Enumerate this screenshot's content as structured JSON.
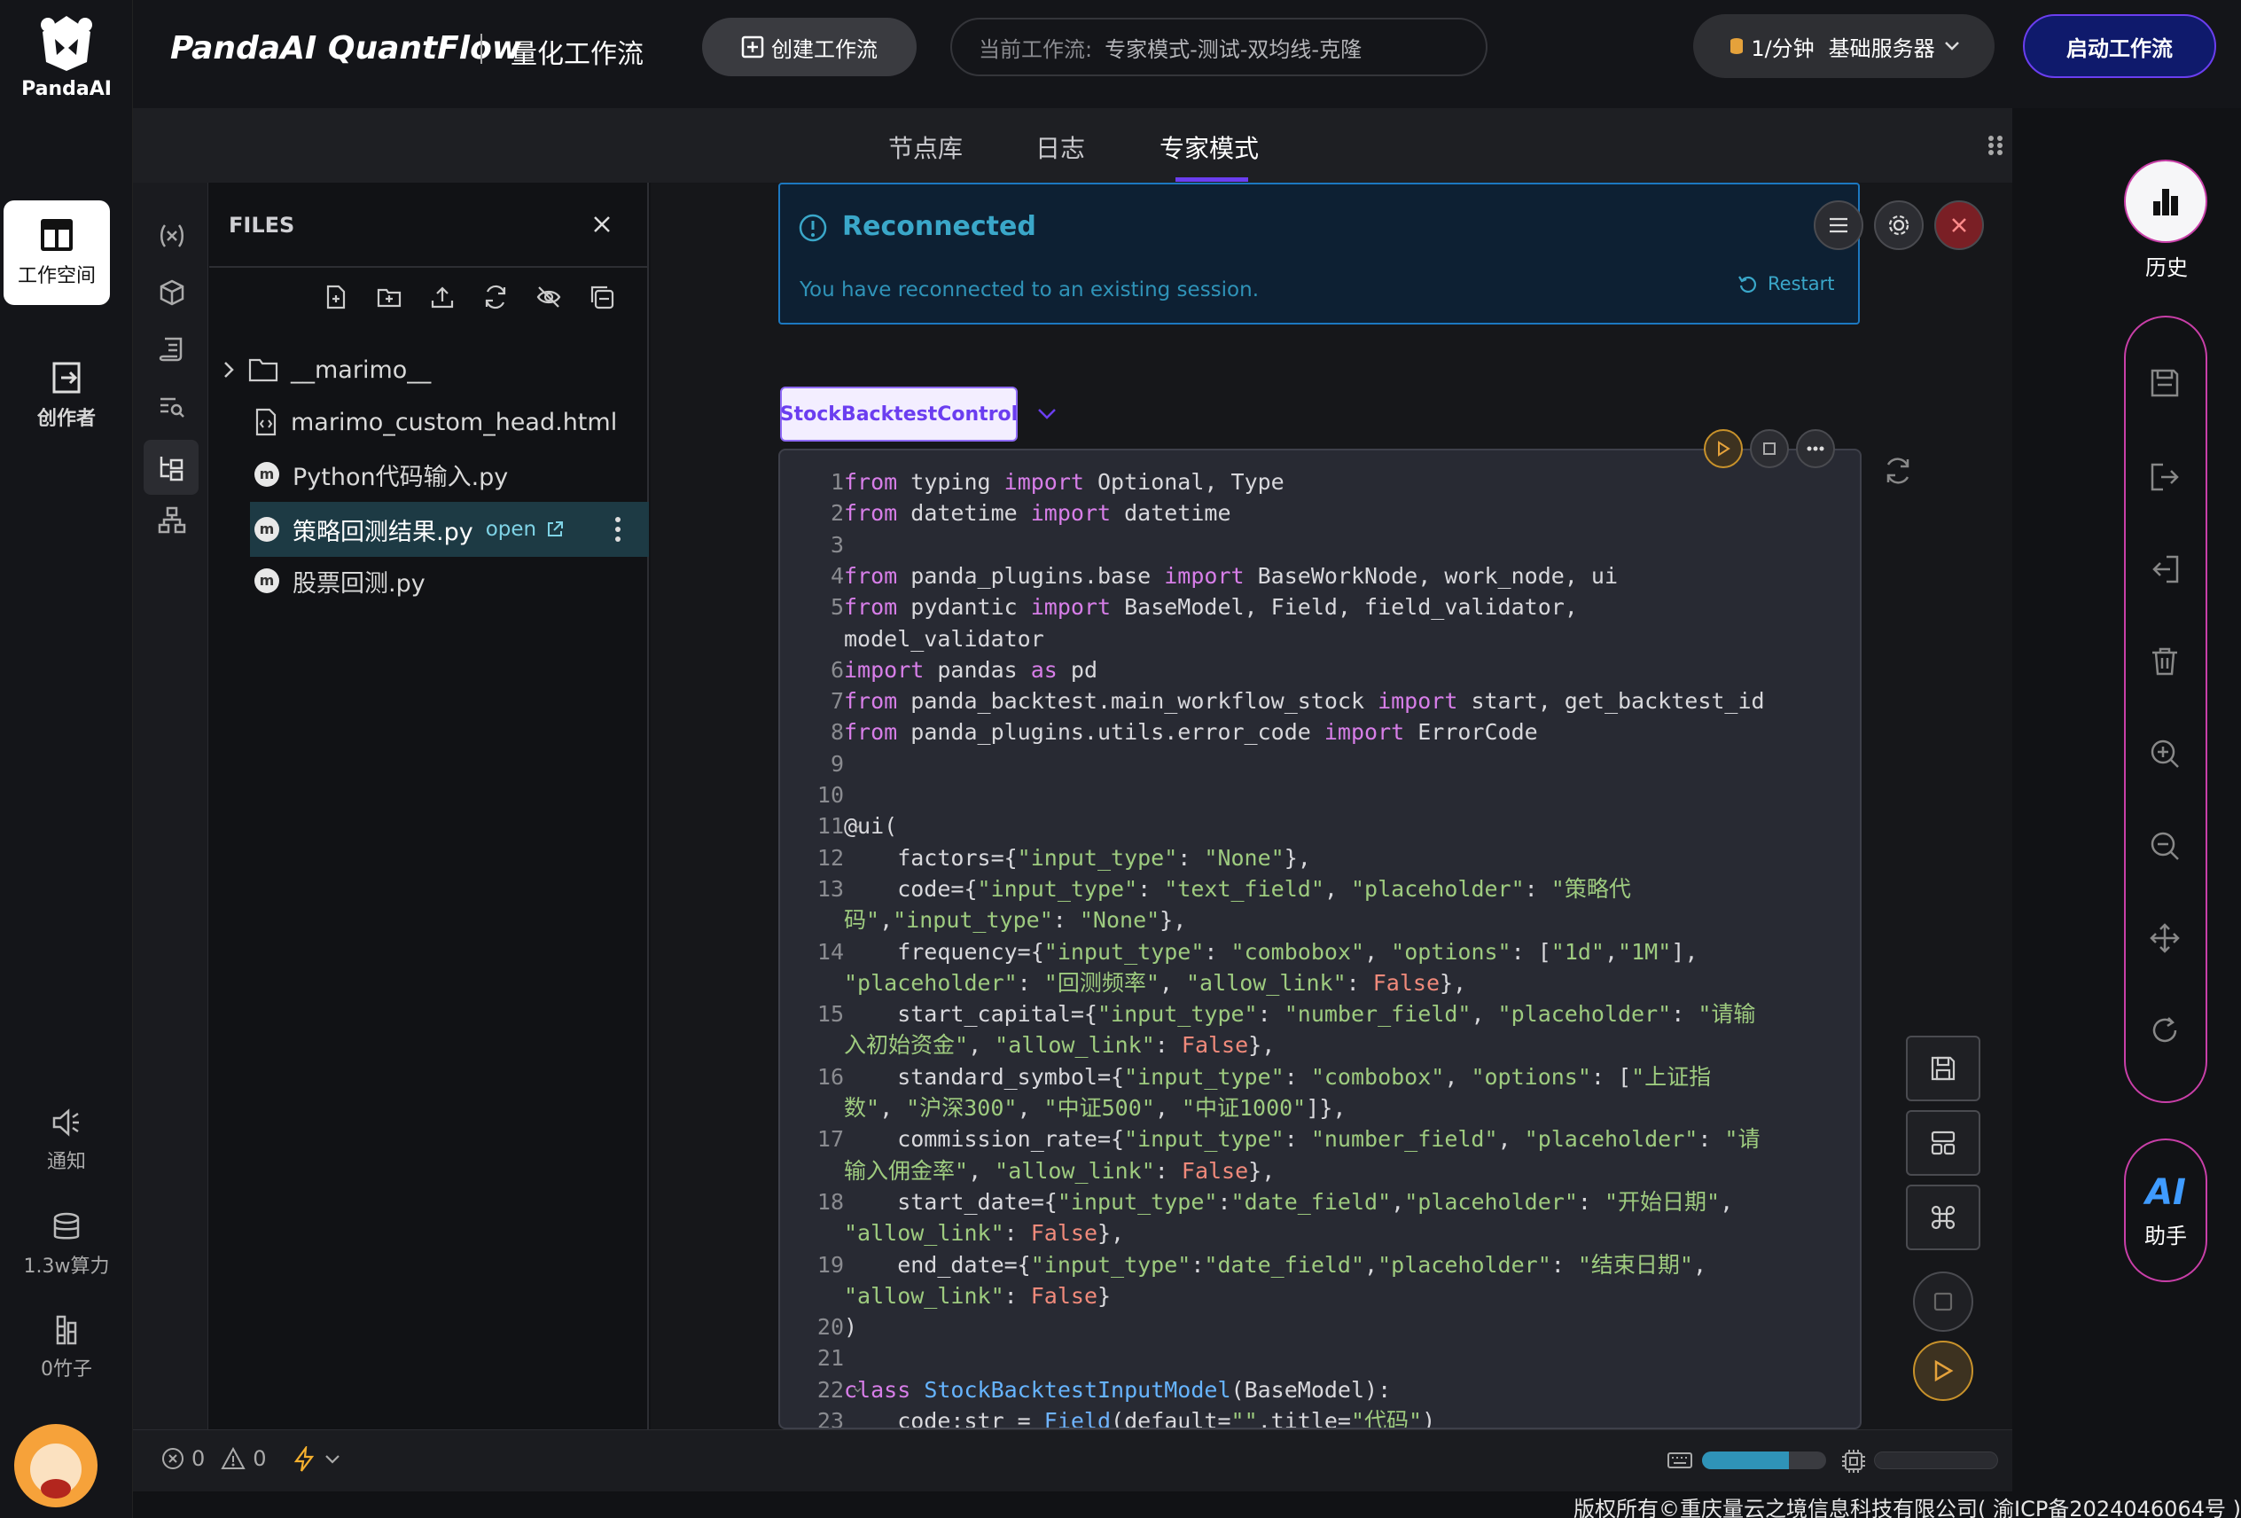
{
  "brand": {
    "logo_text": "PandaAI",
    "app_title": "PandaAI QuantFlow",
    "app_subtitle": "量化工作流"
  },
  "header": {
    "create_button": "创建工作流",
    "current_workflow_label": "当前工作流:",
    "current_workflow_name": "专家模式-测试-双均线-克隆",
    "server_rate": "1/分钟",
    "server_type": "基础服务器",
    "start_button": "启动工作流"
  },
  "left_rail": {
    "workspace": "工作空间",
    "creator": "创作者",
    "notify": "通知",
    "compute": "1.3w算力",
    "bamboo": "0竹子"
  },
  "tabs": [
    {
      "label": "节点库",
      "active": false
    },
    {
      "label": "日志",
      "active": false
    },
    {
      "label": "专家模式",
      "active": true
    }
  ],
  "files": {
    "title": "FILES",
    "items": [
      {
        "name": "__marimo__",
        "type": "folder"
      },
      {
        "name": "marimo_custom_head.html",
        "type": "html"
      },
      {
        "name": "Python代码输入.py",
        "type": "marimo"
      },
      {
        "name": "策略回测结果.py",
        "type": "marimo",
        "selected": true,
        "badge": "open"
      },
      {
        "name": "股票回测.py",
        "type": "marimo"
      }
    ]
  },
  "notice": {
    "title": "Reconnected",
    "message": "You have reconnected to an existing session.",
    "restart": "Restart"
  },
  "cell": {
    "name": "StockBacktestControl"
  },
  "code_lines": [
    {
      "n": "1",
      "fold": "",
      "html": "<span class='kw'>from</span> typing <span class='kw'>import</span> Optional, Type"
    },
    {
      "n": "2",
      "fold": "",
      "html": "<span class='kw'>from</span> datetime <span class='kw'>import</span> datetime"
    },
    {
      "n": "3",
      "fold": "",
      "html": ""
    },
    {
      "n": "4",
      "fold": "",
      "html": "<span class='kw'>from</span> panda_plugins.base <span class='kw'>import</span> BaseWorkNode, work_node, ui"
    },
    {
      "n": "5",
      "fold": "",
      "html": "<span class='kw'>from</span> pydantic <span class='kw'>import</span> BaseModel, Field, field_validator,"
    },
    {
      "n": "",
      "fold": "",
      "html": "model_validator"
    },
    {
      "n": "6",
      "fold": "",
      "html": "<span class='kw'>import</span> pandas <span class='kw'>as</span> pd"
    },
    {
      "n": "7",
      "fold": "",
      "html": "<span class='kw'>from</span> panda_backtest.main_workflow_stock <span class='kw'>import</span> start, get_backtest_id"
    },
    {
      "n": "8",
      "fold": "",
      "html": "<span class='kw'>from</span> panda_plugins.utils.error_code <span class='kw'>import</span> ErrorCode"
    },
    {
      "n": "9",
      "fold": "",
      "html": ""
    },
    {
      "n": "10",
      "fold": "",
      "html": ""
    },
    {
      "n": "11",
      "fold": "v",
      "html": "@ui("
    },
    {
      "n": "12",
      "fold": "",
      "html": "    factors={<span class='str'>\"input_type\"</span>: <span class='str'>\"None\"</span>},"
    },
    {
      "n": "13",
      "fold": "",
      "html": "    code={<span class='str'>\"input_type\"</span>: <span class='str'>\"text_field\"</span>, <span class='str'>\"placeholder\"</span>: <span class='str'>\"策略代</span>"
    },
    {
      "n": "",
      "fold": "",
      "html": "<span class='str'>码\"</span>,<span class='str'>\"input_type\"</span>: <span class='str'>\"None\"</span>},"
    },
    {
      "n": "14",
      "fold": "",
      "html": "    frequency={<span class='str'>\"input_type\"</span>: <span class='str'>\"combobox\"</span>, <span class='str'>\"options\"</span>: [<span class='str'>\"1d\"</span>,<span class='str'>\"1M\"</span>],"
    },
    {
      "n": "",
      "fold": "",
      "html": "<span class='str'>\"placeholder\"</span>: <span class='str'>\"回测频率\"</span>, <span class='str'>\"allow_link\"</span>: <span class='bool'>False</span>},"
    },
    {
      "n": "15",
      "fold": "",
      "html": "    start_capital={<span class='str'>\"input_type\"</span>: <span class='str'>\"number_field\"</span>, <span class='str'>\"placeholder\"</span>: <span class='str'>\"请输</span>"
    },
    {
      "n": "",
      "fold": "",
      "html": "<span class='str'>入初始资金\"</span>, <span class='str'>\"allow_link\"</span>: <span class='bool'>False</span>},"
    },
    {
      "n": "16",
      "fold": "",
      "html": "    standard_symbol={<span class='str'>\"input_type\"</span>: <span class='str'>\"combobox\"</span>, <span class='str'>\"options\"</span>: [<span class='str'>\"上证指</span>"
    },
    {
      "n": "",
      "fold": "",
      "html": "<span class='str'>数\"</span>, <span class='str'>\"沪深300\"</span>, <span class='str'>\"中证500\"</span>, <span class='str'>\"中证1000\"</span>]},"
    },
    {
      "n": "17",
      "fold": "",
      "html": "    commission_rate={<span class='str'>\"input_type\"</span>: <span class='str'>\"number_field\"</span>, <span class='str'>\"placeholder\"</span>: <span class='str'>\"请</span>"
    },
    {
      "n": "",
      "fold": "",
      "html": "<span class='str'>输入佣金率\"</span>, <span class='str'>\"allow_link\"</span>: <span class='bool'>False</span>},"
    },
    {
      "n": "18",
      "fold": "",
      "html": "    start_date={<span class='str'>\"input_type\"</span>:<span class='str'>\"date_field\"</span>,<span class='str'>\"placeholder\"</span>: <span class='str'>\"开始日期\"</span>,"
    },
    {
      "n": "",
      "fold": "",
      "html": "<span class='str'>\"allow_link\"</span>: <span class='bool'>False</span>},"
    },
    {
      "n": "19",
      "fold": "",
      "html": "    end_date={<span class='str'>\"input_type\"</span>:<span class='str'>\"date_field\"</span>,<span class='str'>\"placeholder\"</span>: <span class='str'>\"结束日期\"</span>,"
    },
    {
      "n": "",
      "fold": "",
      "html": "<span class='str'>\"allow_link\"</span>: <span class='bool'>False</span>}"
    },
    {
      "n": "20",
      "fold": "",
      "html": ")"
    },
    {
      "n": "21",
      "fold": "",
      "html": ""
    },
    {
      "n": "22",
      "fold": "v",
      "html": "<span class='kw'>class</span> <span class='cls'>StockBacktestInputModel</span>(BaseModel):"
    },
    {
      "n": "23",
      "fold": "",
      "html": "    code:str = <span class='fn'>Field</span>(default=<span class='str'>\"\"</span>,title=<span class='str'>\"代码\"</span>)"
    }
  ],
  "right_rail": {
    "history": "历史",
    "ai": "AI",
    "assistant": "助手"
  },
  "status": {
    "errors": "0",
    "warnings": "0"
  },
  "footer": {
    "copyright": "版权所有©重庆量云之境信息科技有限公司( 渝ICP备2024046064号 )"
  },
  "colors": {
    "accent": "#6b3ef0",
    "pink": "#c93fa8",
    "notice_bg": "#0d2033",
    "notice_border": "#1c78c0",
    "teal": "#2f93b8"
  }
}
